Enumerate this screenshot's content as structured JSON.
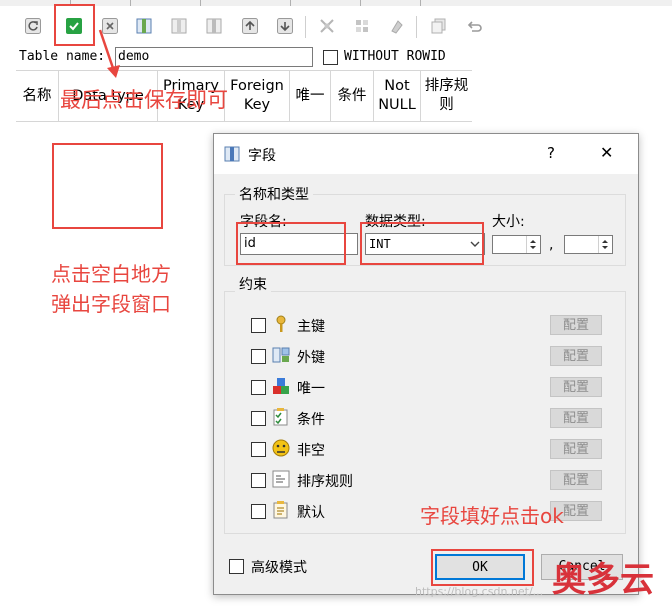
{
  "toolbar": {
    "icons": [
      "refresh-icon",
      "save-check-icon",
      "delete-icon",
      "add-column-icon",
      "insert-column-icon",
      "remove-column-icon",
      "move-up-icon",
      "move-down-icon",
      "add-index-icon",
      "remove-index-icon",
      "clear-icon",
      "copy-icon",
      "undo-icon"
    ]
  },
  "table": {
    "name_label": "Table name:",
    "name_value": "demo",
    "without_rowid_label": "WITHOUT ROWID"
  },
  "columns": {
    "name": "名称",
    "data_type": "Data type",
    "primary_key": "Primary\nKey",
    "foreign_key": "Foreign\nKey",
    "unique": "唯一",
    "condition": "条件",
    "not_null": "Not\nNULL",
    "collation": "排序规则"
  },
  "annotations": {
    "save_hint": "最后点击保存即可",
    "click_blank_line1": "点击空白地方",
    "click_blank_line2": "弹出字段窗口",
    "fill_hint": "字段填好点击ok"
  },
  "dialog": {
    "title": "字段",
    "help": "?",
    "close": "✕",
    "group_name_type": "名称和类型",
    "field_name_label": "字段名:",
    "field_name_value": "id",
    "data_type_label": "数据类型:",
    "data_type_value": "INT",
    "size_label": "大小:",
    "size_sep": ",",
    "group_constraints": "约束",
    "constraints": [
      {
        "label": "主键",
        "icon": "key-icon",
        "button": "配置"
      },
      {
        "label": "外键",
        "icon": "foreign-key-icon",
        "button": "配置"
      },
      {
        "label": "唯一",
        "icon": "unique-icon",
        "button": "配置"
      },
      {
        "label": "条件",
        "icon": "check-condition-icon",
        "button": "配置"
      },
      {
        "label": "非空",
        "icon": "not-null-icon",
        "button": "配置"
      },
      {
        "label": "排序规则",
        "icon": "collation-icon",
        "button": "配置"
      },
      {
        "label": "默认",
        "icon": "default-icon",
        "button": "配置"
      }
    ],
    "advanced_mode": "高级模式",
    "ok": "OK",
    "cancel": "Cancel"
  },
  "watermark": {
    "url": "https://blog.csdn.net/...",
    "brand": "奥多云"
  },
  "colors": {
    "annotation_red": "#e8463f",
    "accent_blue": "#0078d7",
    "save_green": "#27a243"
  }
}
